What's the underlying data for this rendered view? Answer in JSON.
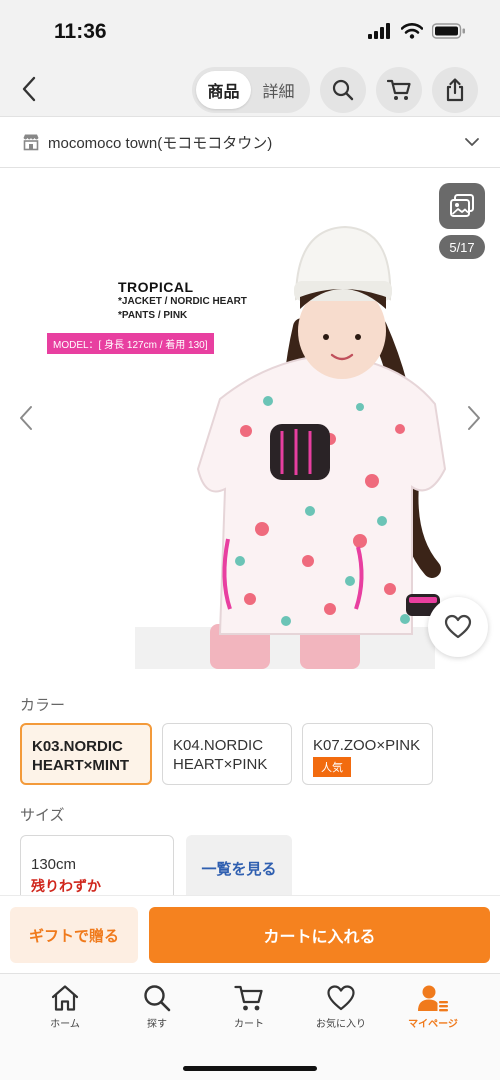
{
  "status": {
    "time": "11:36"
  },
  "nav": {
    "tabs": [
      {
        "label": "商品"
      },
      {
        "label": "詳細"
      }
    ]
  },
  "shop": {
    "name": "mocomoco town(モコモコタウン)"
  },
  "gallery": {
    "counter": "5/17",
    "photo_title": "TROPICAL",
    "photo_line1": "*JACKET / NORDIC HEART",
    "photo_line2": "*PANTS / PINK",
    "model_tag": "MODEL：[ 身長 127cm / 着用 130]"
  },
  "color": {
    "label": "カラー",
    "options": [
      {
        "name_line1": "K03.NORDIC",
        "name_line2": "HEART×MINT",
        "badge": ""
      },
      {
        "name_line1": "K04.NORDIC",
        "name_line2": "HEART×PINK",
        "badge": ""
      },
      {
        "name_line1": "K07.ZOO×PINK",
        "name_line2": "",
        "badge": "人気"
      }
    ]
  },
  "size": {
    "label": "サイズ",
    "options": [
      {
        "name": "130cm",
        "stock": "残りわずか"
      }
    ],
    "list_link": "一覧を見る"
  },
  "actions": {
    "gift_label": "ギフトで贈る",
    "cart_label": "カートに入れる"
  },
  "tabbar": {
    "items": [
      {
        "label": "ホーム",
        "icon": "home-icon"
      },
      {
        "label": "探す",
        "icon": "search-icon"
      },
      {
        "label": "カート",
        "icon": "cart-icon"
      },
      {
        "label": "お気に入り",
        "icon": "heart-icon"
      },
      {
        "label": "マイページ",
        "icon": "user-icon"
      }
    ]
  },
  "colors": {
    "accent": "#f5821f",
    "selected_border": "#f39a3a",
    "stock_red": "#d0261c",
    "badge_pink": "#e83fa0"
  }
}
